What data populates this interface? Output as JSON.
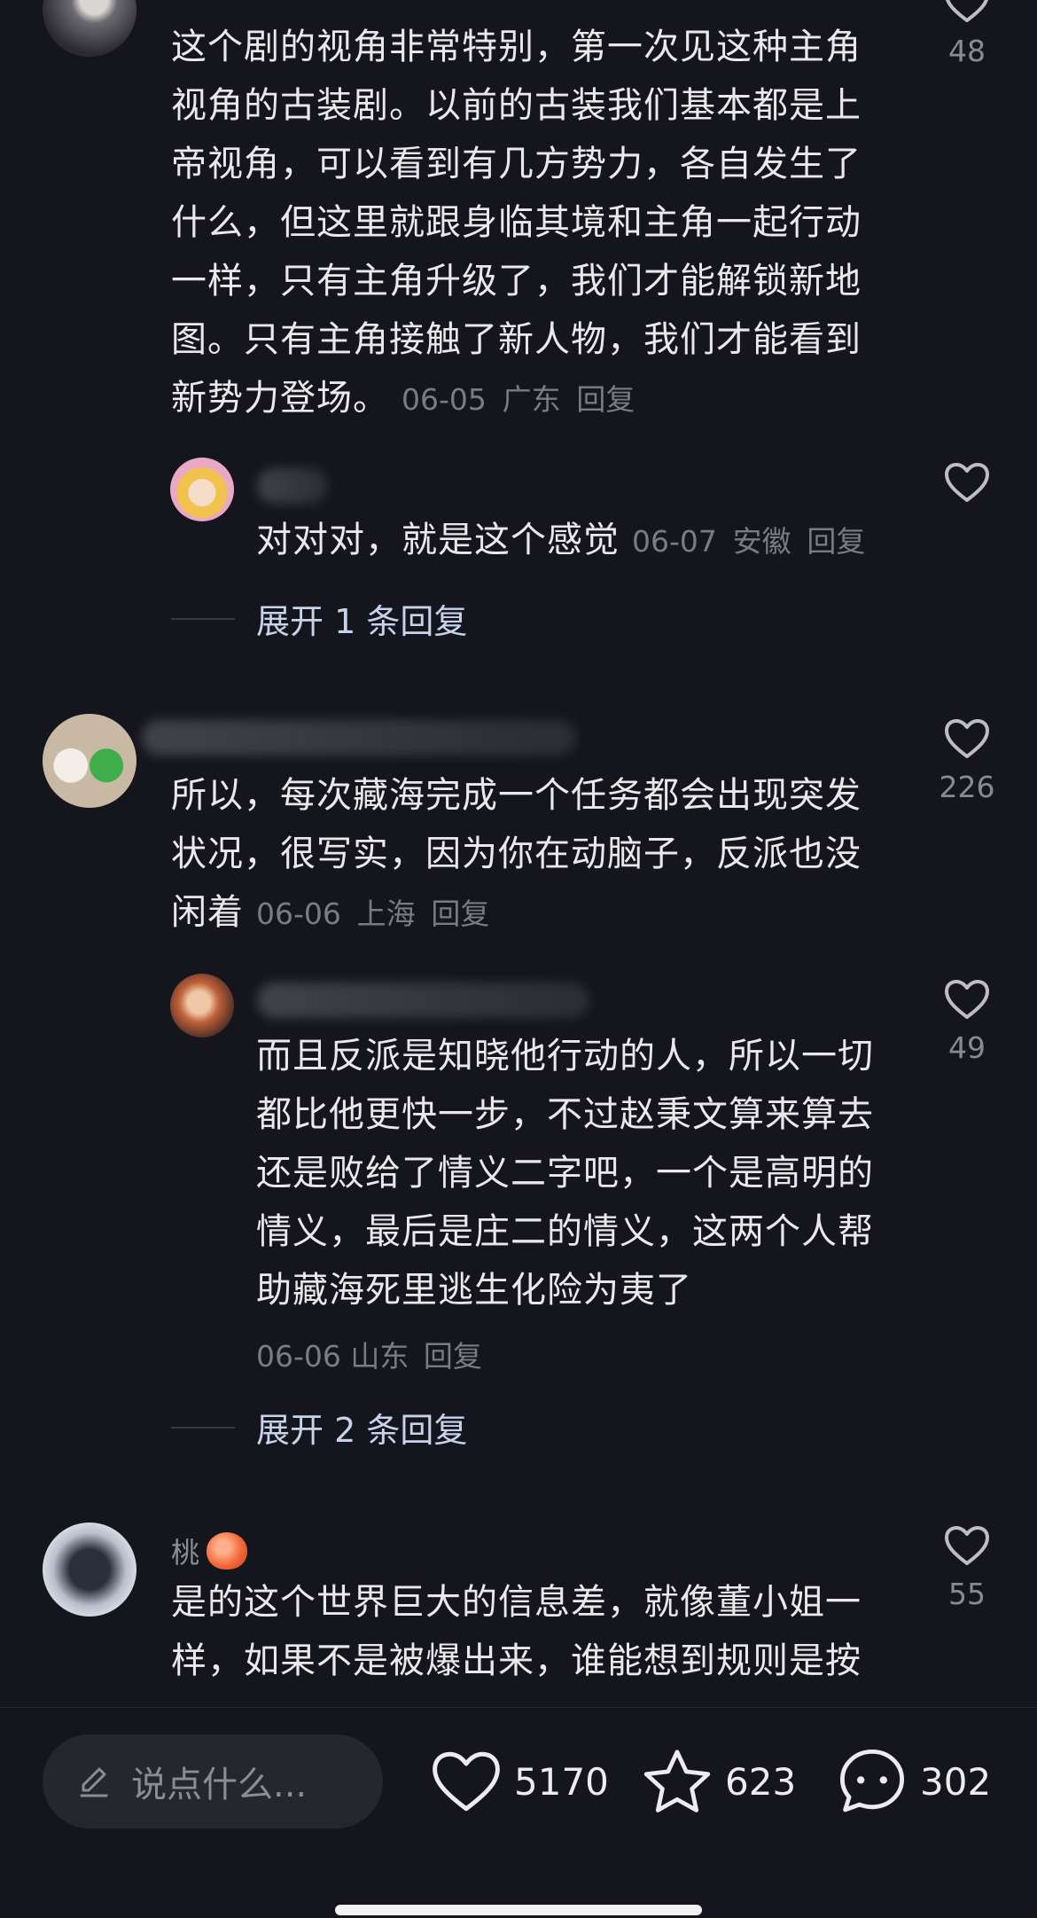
{
  "comments": [
    {
      "text": "这个剧的视角非常特别，第一次见这种主角视角的古装剧。以前的古装我们基本都是上帝视角，可以看到有几方势力，各自发生了什么，但这里就跟身临其境和主角一起行动一样，只有主角升级了，我们才能解锁新地图。只有主角接触了新人物，我们才能看到新势力登场。",
      "lines": [
        "这个剧的视角非常特别，第一次见这种主角",
        "视角的古装剧。以前的古装我们基本都是上",
        "帝视角，可以看到有几方势力，各自发生了",
        "什么，但这里就跟身临其境和主角一起行动",
        "一样，只有主角升级了，我们才能解锁新地",
        "图。只有主角接触了新人物，我们才能看到",
        "新势力登场。"
      ],
      "date": "06-05",
      "location": "广东",
      "reply": "回复",
      "likes": "48"
    },
    {
      "text": "对对对，就是这个感觉",
      "date": "06-07",
      "location": "安徽",
      "reply": "回复",
      "likes": "",
      "expand": "展开 1 条回复"
    },
    {
      "lines": [
        "所以，每次藏海完成一个任务都会出现突发",
        "状况，很写实，因为你在动脑子，反派也没",
        "闲着"
      ],
      "date": "06-06",
      "location": "上海",
      "reply": "回复",
      "likes": "226"
    },
    {
      "lines": [
        "而且反派是知晓他行动的人，所以一切",
        "都比他更快一步，不过赵秉文算来算去",
        "还是败给了情义二字吧，一个是高明的",
        "情义，最后是庄二的情义，这两个人帮",
        "助藏海死里逃生化险为夷了"
      ],
      "date": "06-06",
      "location": "山东",
      "reply": "回复",
      "likes": "49",
      "expand": "展开 2 条回复"
    },
    {
      "username_visible": "桃",
      "lines": [
        "是的这个世界巨大的信息差，就像董小姐一",
        "样，如果不是被爆出来，谁能想到规则是按"
      ],
      "likes": "55"
    }
  ],
  "bottom_bar": {
    "input_placeholder": "说点什么...",
    "likes": "5170",
    "favorites": "623",
    "comments": "302"
  },
  "colors": {
    "background": "#15151d",
    "text": "#e9e9eb",
    "meta": "#7b7b83",
    "expand_link": "#c7d3ea"
  }
}
